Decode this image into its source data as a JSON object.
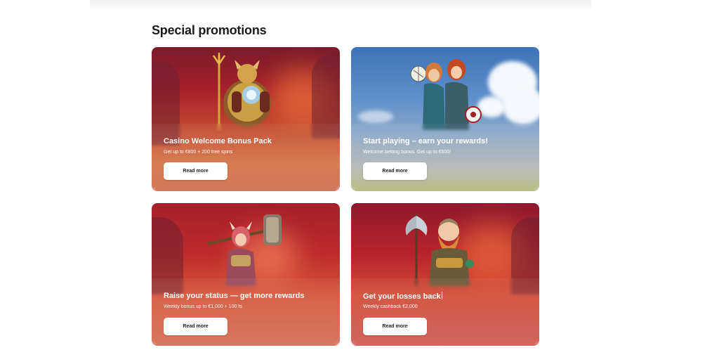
{
  "page": {
    "section_title": "Special promotions"
  },
  "promotions": [
    {
      "title": "Casino Welcome Bonus Pack",
      "subtitle": "Get up to €800 + 200 free spins",
      "button_label": "Read more",
      "art": "armored-warrior-with-trident-icon"
    },
    {
      "title": "Start playing – earn your rewards!",
      "subtitle": "Welcome betting bonus. Get up to €600!",
      "button_label": "Read more",
      "art": "two-athletes-with-balls-icon"
    },
    {
      "title": "Raise your status — get more rewards",
      "subtitle": "Weekly bonus up to €1,000 + 100 fs",
      "button_label": "Read more",
      "art": "viking-warrior-with-hammer-icon"
    },
    {
      "title": "Get your losses back",
      "subtitle": "Weekly cashback €2,000",
      "button_label": "Read more",
      "art": "dwarf-warrior-with-axe-icon"
    }
  ],
  "colors": {
    "card_red": "#b8222c",
    "card_sky": "#5d8fcb",
    "button_bg": "#ffffff",
    "title_text": "#1b1b1b"
  }
}
